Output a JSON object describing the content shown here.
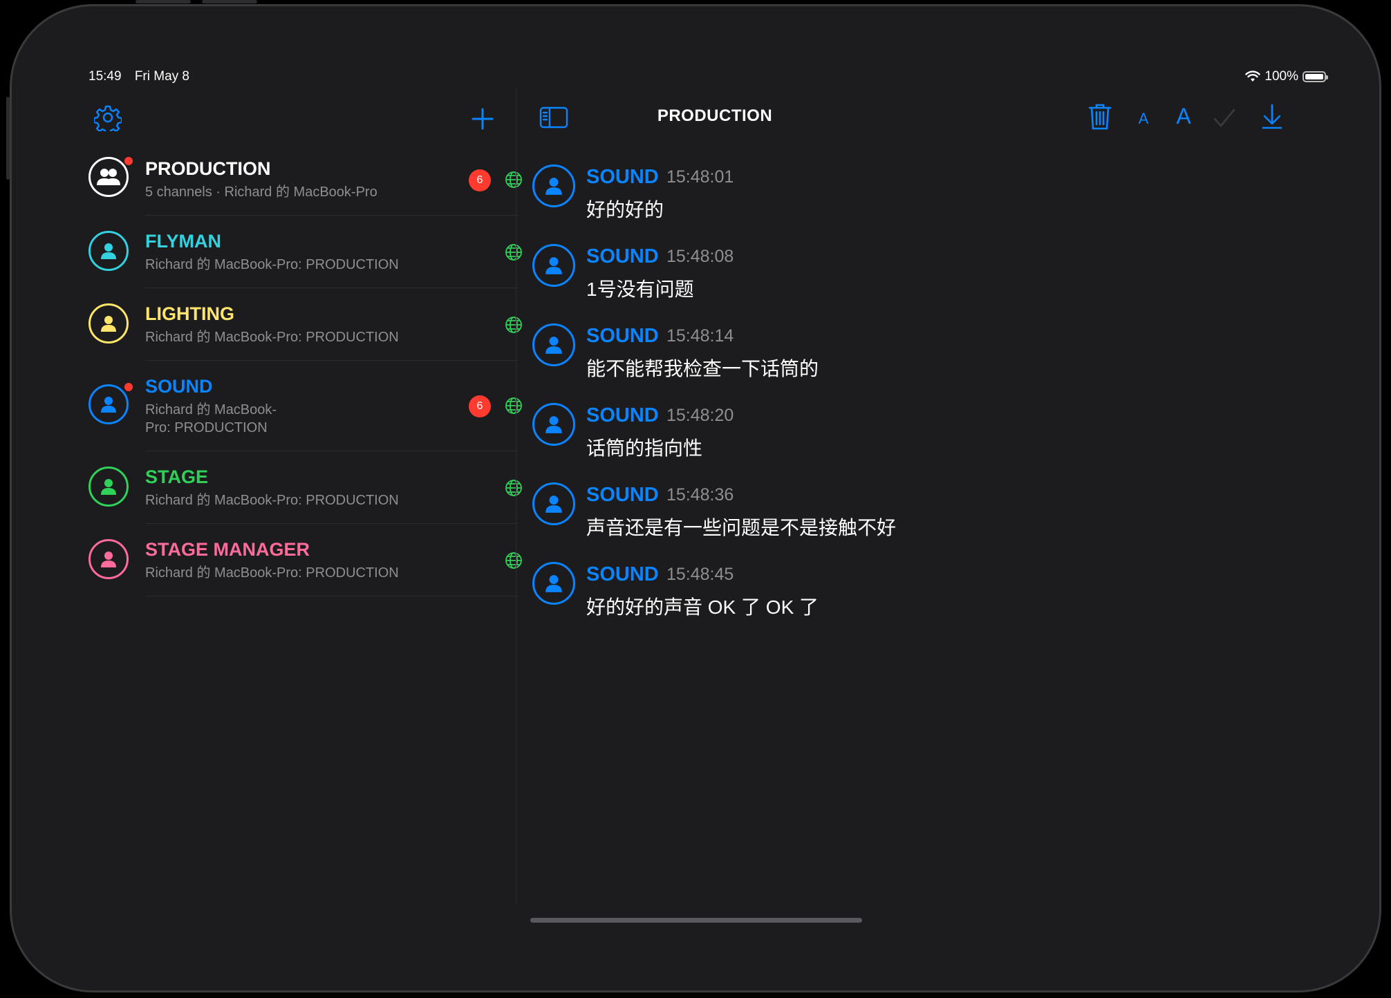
{
  "status": {
    "time": "15:49",
    "date": "Fri May 8",
    "battery": "100%"
  },
  "sidebar": {
    "channels": [
      {
        "name": "PRODUCTION",
        "subtitle": "5 channels · Richard 的 MacBook-Pro",
        "badge": "6",
        "unread_dot": true,
        "color": "#ffffff",
        "icon": "group-icon"
      },
      {
        "name": "FLYMAN",
        "subtitle": "Richard 的 MacBook-Pro: PRODUCTION",
        "badge": "",
        "unread_dot": false,
        "color": "#32d2e0",
        "icon": "person-icon"
      },
      {
        "name": "LIGHTING",
        "subtitle": "Richard 的 MacBook-Pro: PRODUCTION",
        "badge": "",
        "unread_dot": false,
        "color": "#ffe66b",
        "icon": "person-icon"
      },
      {
        "name": "SOUND",
        "subtitle_line1": "Richard 的 MacBook-",
        "subtitle_line2": "Pro: PRODUCTION",
        "badge": "6",
        "unread_dot": true,
        "color": "#0a84ff",
        "icon": "person-icon"
      },
      {
        "name": "STAGE",
        "subtitle": "Richard 的 MacBook-Pro: PRODUCTION",
        "badge": "",
        "unread_dot": false,
        "color": "#30d158",
        "icon": "person-icon"
      },
      {
        "name": "STAGE MANAGER",
        "subtitle": "Richard 的 MacBook-Pro: PRODUCTION",
        "badge": "",
        "unread_dot": false,
        "color": "#ff6b9a",
        "icon": "person-icon"
      }
    ]
  },
  "detail": {
    "title": "PRODUCTION",
    "toolbar": {
      "font_small": "A",
      "font_large": "A"
    },
    "messages": [
      {
        "sender": "SOUND",
        "time": "15:48:01",
        "text": "好的好的"
      },
      {
        "sender": "SOUND",
        "time": "15:48:08",
        "text": "1号没有问题"
      },
      {
        "sender": "SOUND",
        "time": "15:48:14",
        "text": "能不能帮我检查一下话筒的"
      },
      {
        "sender": "SOUND",
        "time": "15:48:20",
        "text": "话筒的指向性"
      },
      {
        "sender": "SOUND",
        "time": "15:48:36",
        "text": "声音还是有一些问题是不是接触不好"
      },
      {
        "sender": "SOUND",
        "time": "15:48:45",
        "text": "好的好的声音 OK 了 OK 了"
      }
    ]
  },
  "colors": {
    "accent": "#0a84ff",
    "badge": "#ff3b30",
    "globe": "#30d158"
  }
}
